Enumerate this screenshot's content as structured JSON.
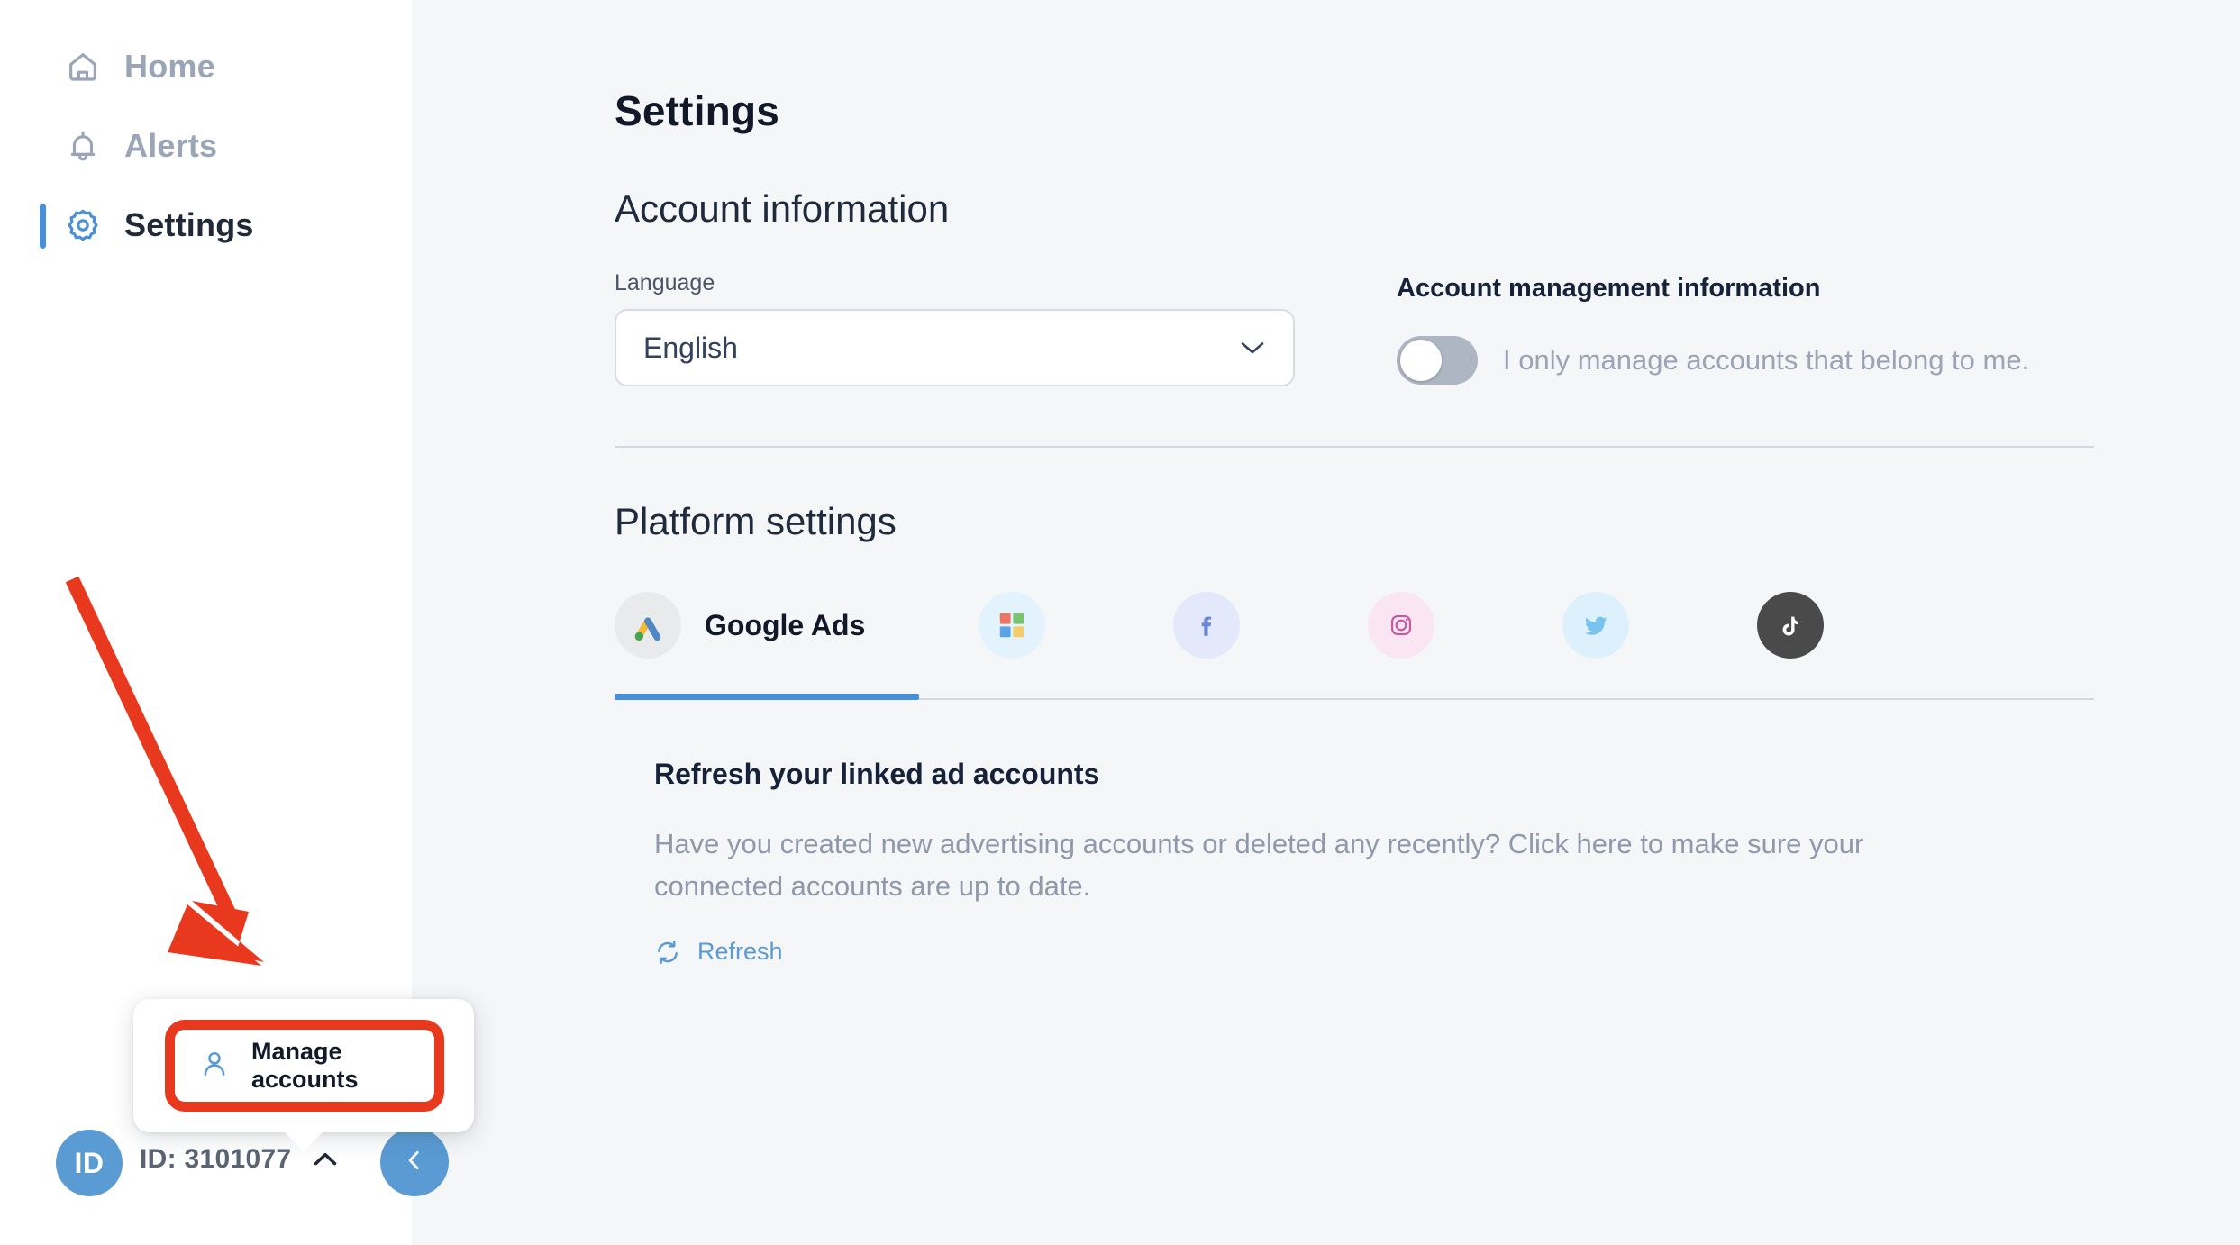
{
  "sidebar": {
    "items": [
      {
        "label": "Home",
        "icon": "home-icon",
        "active": false
      },
      {
        "label": "Alerts",
        "icon": "bell-icon",
        "active": false
      },
      {
        "label": "Settings",
        "icon": "gear-icon",
        "active": true
      }
    ],
    "footer": {
      "avatar_label": "ID",
      "account_id_text": "ID: 3101077",
      "expand_icon": "chevron-up-icon",
      "collapse_icon": "chevron-left-icon"
    },
    "popup": {
      "items": [
        {
          "label": "Manage accounts",
          "icon": "user-icon"
        }
      ]
    }
  },
  "main": {
    "page_title": "Settings",
    "account_section": {
      "title": "Account information",
      "language": {
        "label": "Language",
        "value": "English",
        "caret_icon": "chevron-down-icon"
      },
      "account_management": {
        "title": "Account management information",
        "toggle_label": "I only manage accounts that belong to me.",
        "toggle_on": false
      }
    },
    "platform_section": {
      "title": "Platform settings",
      "tabs": [
        {
          "label": "Google Ads",
          "icon": "google-ads-icon",
          "active": true
        },
        {
          "label": "",
          "icon": "microsoft-ads-icon",
          "active": false
        },
        {
          "label": "",
          "icon": "facebook-icon",
          "active": false
        },
        {
          "label": "",
          "icon": "instagram-icon",
          "active": false
        },
        {
          "label": "",
          "icon": "twitter-icon",
          "active": false
        },
        {
          "label": "",
          "icon": "tiktok-icon",
          "active": false
        }
      ],
      "refresh": {
        "title": "Refresh your linked ad accounts",
        "description": "Have you created new advertising accounts or deleted any recently? Click here to make sure your connected accounts are up to date.",
        "link_label": "Refresh",
        "link_icon": "refresh-icon"
      }
    }
  },
  "annotation": {
    "arrow_color": "#e8391e",
    "highlight_color": "#e8391e"
  },
  "colors": {
    "accent_blue": "#4a90d9",
    "avatar_blue": "#5a9bd4",
    "sidebar_bg": "#ffffff",
    "main_bg": "#f4f6f8",
    "text_dark": "#111827",
    "text_muted": "#8f99ab"
  }
}
